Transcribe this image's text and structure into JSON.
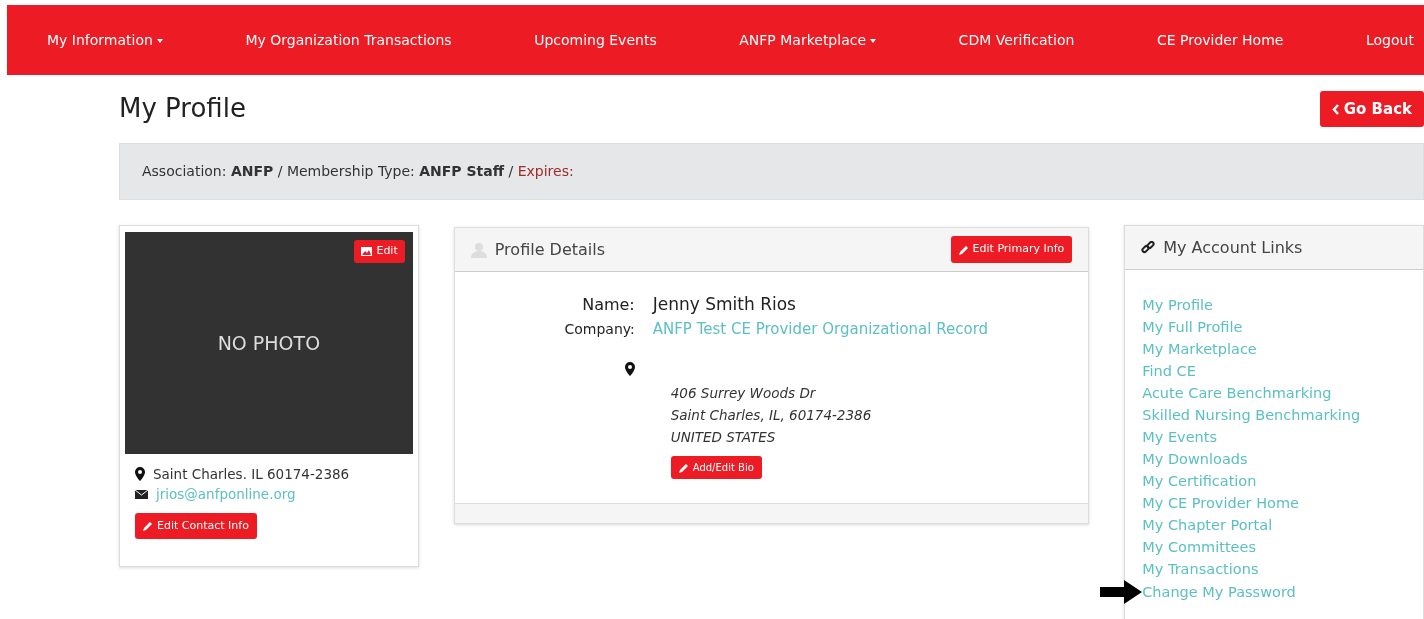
{
  "nav": [
    {
      "label": "My Information",
      "dropdown": true
    },
    {
      "label": "My Organization Transactions",
      "dropdown": false
    },
    {
      "label": "Upcoming Events",
      "dropdown": false
    },
    {
      "label": "ANFP Marketplace",
      "dropdown": true
    },
    {
      "label": "CDM Verification",
      "dropdown": false
    },
    {
      "label": "CE Provider Home",
      "dropdown": false
    },
    {
      "label": "Logout",
      "dropdown": false
    }
  ],
  "page_title": "My Profile",
  "back_button": "Go Back",
  "membership": {
    "text": "Association: **ANFP** / Membership Type: **ANFP Staff** / ",
    "expires": "Expires:"
  },
  "photo_card": {
    "placeholder_text": "NO PHOTO",
    "edit_button": "Edit",
    "location": "Saint Charles. IL 60174-2386",
    "email": "jrios@anfponline.org",
    "edit_contact_button": "Edit Contact Info"
  },
  "profile_details": {
    "title": "Profile Details",
    "edit_button": "Edit Primary Info",
    "fields": [
      {
        "label": "Name:",
        "value": "Jenny Smith Rios",
        "kind": "text"
      },
      {
        "label": "Company:",
        "value": "ANFP Test CE Provider Organizational Record",
        "kind": "link"
      }
    ],
    "address": [
      "406 Surrey Woods Dr",
      "Saint Charles, IL, 60174-2386",
      "UNITED STATES"
    ],
    "bio_button": "Add/Edit Bio"
  },
  "account_links": {
    "title": "My Account Links",
    "items": [
      "My Profile",
      "My Full Profile",
      "My Marketplace",
      "Find CE",
      "Acute Care Benchmarking",
      "Skilled Nursing Benchmarking",
      "My Events",
      "My Downloads",
      "My Certification",
      "My CE Provider Home",
      "My Chapter Portal",
      "My Committees",
      "My Transactions",
      "Change My Password"
    ]
  }
}
